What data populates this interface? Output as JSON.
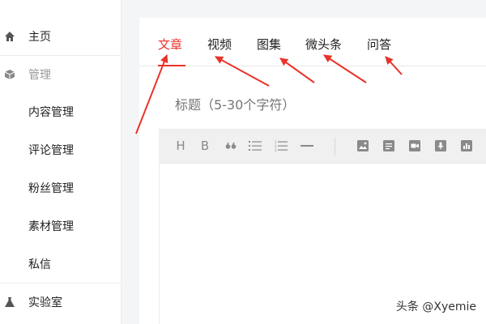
{
  "sidebar": {
    "items": [
      {
        "label": "主页",
        "icon": "home-icon"
      },
      {
        "label": "管理",
        "icon": "cube-icon"
      },
      {
        "label": "内容管理"
      },
      {
        "label": "评论管理"
      },
      {
        "label": "粉丝管理"
      },
      {
        "label": "素材管理"
      },
      {
        "label": "私信"
      },
      {
        "label": "实验室",
        "icon": "flask-icon"
      }
    ]
  },
  "tabs": [
    "文章",
    "视频",
    "图集",
    "微头条",
    "问答"
  ],
  "active_tab": "文章",
  "editor": {
    "title_placeholder": "标题（5-30个字符）",
    "toolbar": [
      "heading-icon",
      "bold-icon",
      "quote-icon",
      "bullet-list-icon",
      "numbered-list-icon",
      "divider-icon",
      "image-icon",
      "document-icon",
      "video-icon",
      "audio-icon",
      "chart-icon"
    ]
  },
  "colors": {
    "accent": "#e8332a",
    "annotation": "#e8332a"
  },
  "watermark": "头条 @Xyemie"
}
